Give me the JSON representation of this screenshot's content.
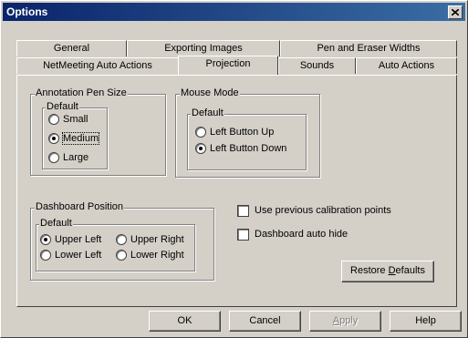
{
  "window": {
    "title": "Options"
  },
  "tabs_row1": [
    {
      "label": "General"
    },
    {
      "label": "Exporting Images"
    },
    {
      "label": "Pen and Eraser Widths"
    }
  ],
  "tabs_row2": [
    {
      "label": "NetMeeting Auto Actions"
    },
    {
      "label": "Projection",
      "active": true
    },
    {
      "label": "Sounds"
    },
    {
      "label": "Auto Actions"
    }
  ],
  "annotation": {
    "title": "Annotation Pen Size",
    "default_label": "Default",
    "options": [
      {
        "label": "Small",
        "checked": false
      },
      {
        "label": "Medium",
        "checked": true
      },
      {
        "label": "Large",
        "checked": false
      }
    ]
  },
  "mouse": {
    "title": "Mouse Mode",
    "default_label": "Default",
    "options": [
      {
        "label": "Left Button Up",
        "checked": false
      },
      {
        "label": "Left Button Down",
        "checked": true
      }
    ]
  },
  "dashboard": {
    "title": "Dashboard Position",
    "default_label": "Default",
    "options": [
      {
        "label": "Upper Left",
        "checked": true
      },
      {
        "label": "Upper Right",
        "checked": false
      },
      {
        "label": "Lower Left",
        "checked": false
      },
      {
        "label": "Lower Right",
        "checked": false
      }
    ]
  },
  "checks": [
    {
      "label": "Use previous calibration points",
      "checked": false
    },
    {
      "label": "Dashboard auto hide",
      "checked": false
    }
  ],
  "restore": {
    "prefix": "Restore ",
    "accel": "D",
    "rest": "efaults"
  },
  "buttons": {
    "ok": "OK",
    "cancel": "Cancel",
    "apply_accel": "A",
    "apply_rest": "pply",
    "help": "Help"
  },
  "icons": {
    "close": "close-icon"
  }
}
